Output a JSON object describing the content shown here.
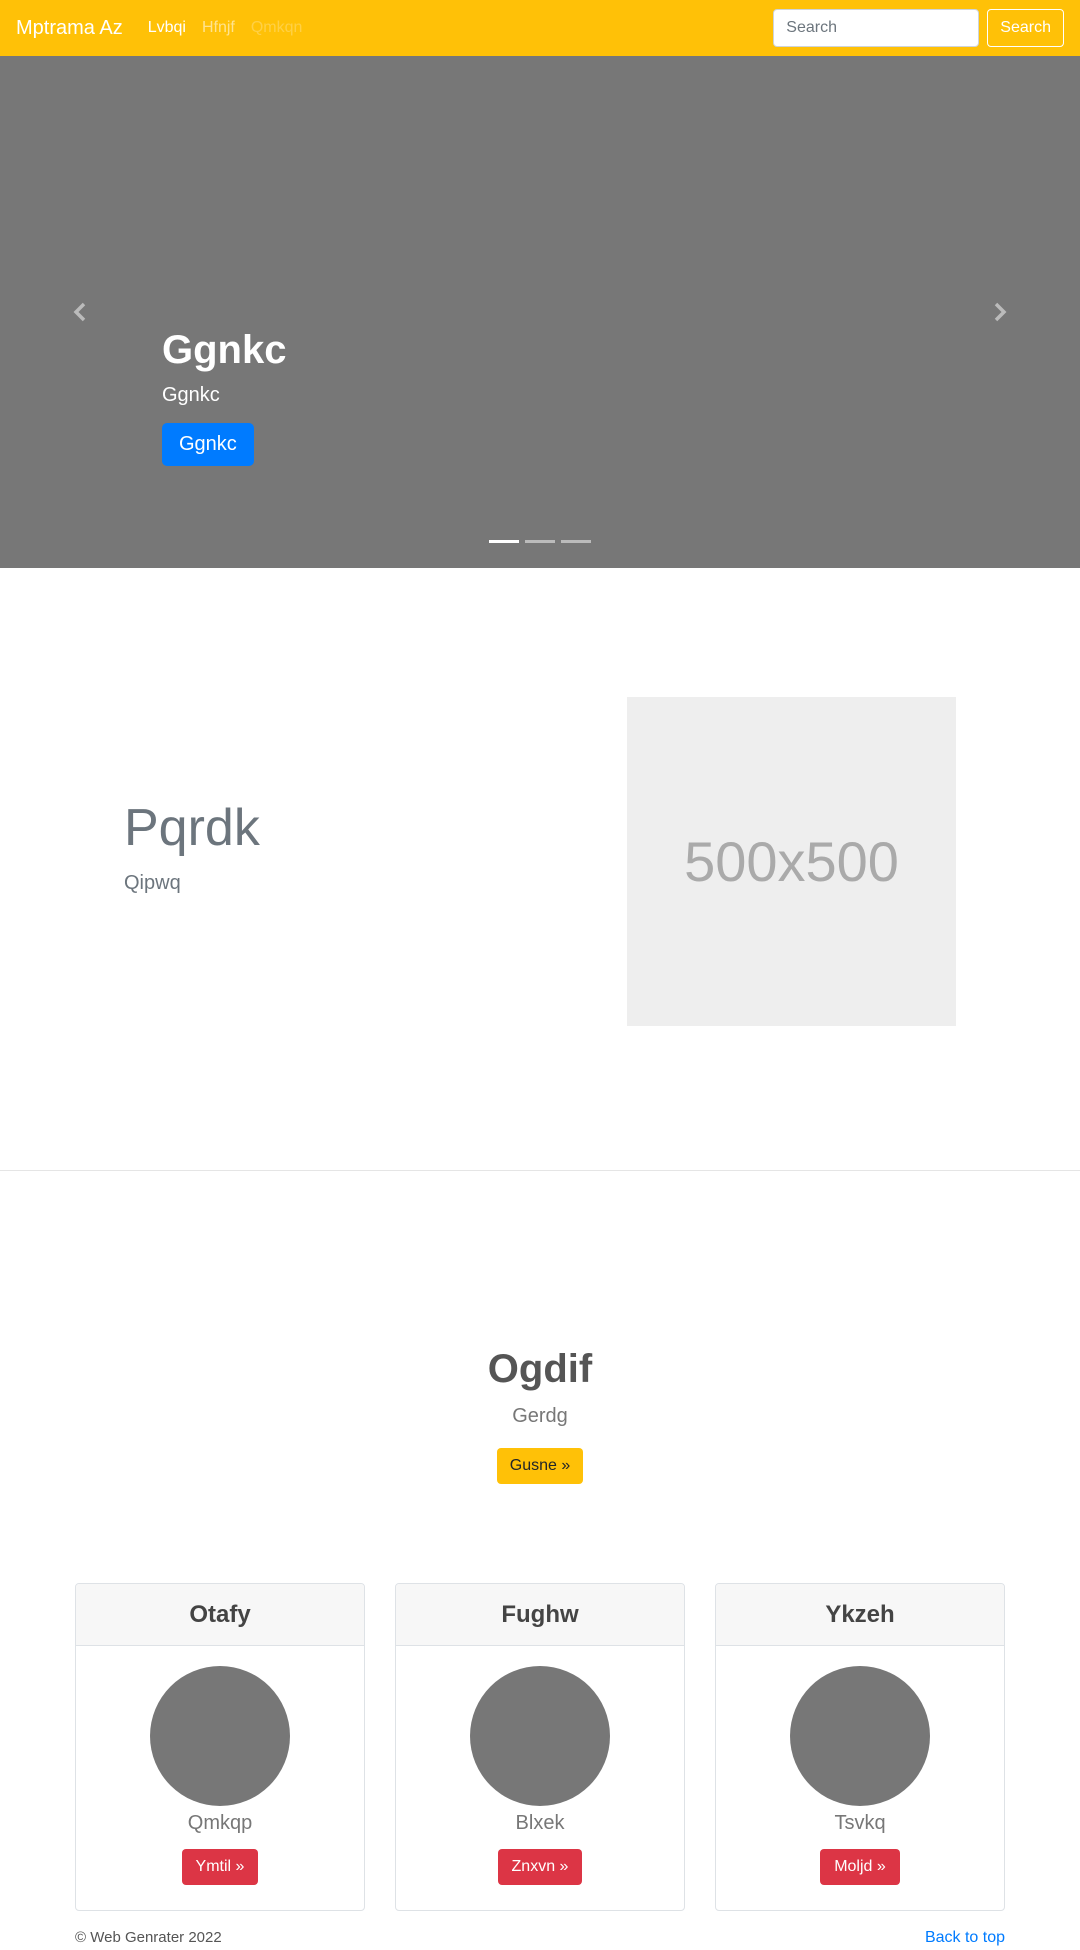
{
  "navbar": {
    "brand": "Mptrama Az",
    "links": [
      {
        "label": "Lvbqi",
        "state": "active"
      },
      {
        "label": "Hfnjf",
        "state": "normal"
      },
      {
        "label": "Qmkqn",
        "state": "disabled"
      }
    ],
    "search_placeholder": "Search",
    "search_button": "Search",
    "color": "#ffc107"
  },
  "carousel": {
    "title": "Ggnkc",
    "subtitle": "Ggnkc",
    "button": "Ggnkc",
    "prev_icon": "chevron-left-icon",
    "next_icon": "chevron-right-icon",
    "slide_count": 3,
    "active_slide": 1
  },
  "feature": {
    "heading": "Pqrdk",
    "lead": "Qipwq",
    "image_label": "500x500"
  },
  "pricing": {
    "title": "Ogdif",
    "lead": "Gerdg",
    "button": "Gusne »"
  },
  "cards": [
    {
      "header": "Otafy",
      "text": "Qmkqp",
      "button": "Ymtil »"
    },
    {
      "header": "Fughw",
      "text": "Blxek",
      "button": "Znxvn »"
    },
    {
      "header": "Ykzeh",
      "text": "Tsvkq",
      "button": "Moljd »"
    }
  ],
  "footer": {
    "copyright": "© Web Genrater 2022",
    "back_to_top": "Back to top"
  }
}
